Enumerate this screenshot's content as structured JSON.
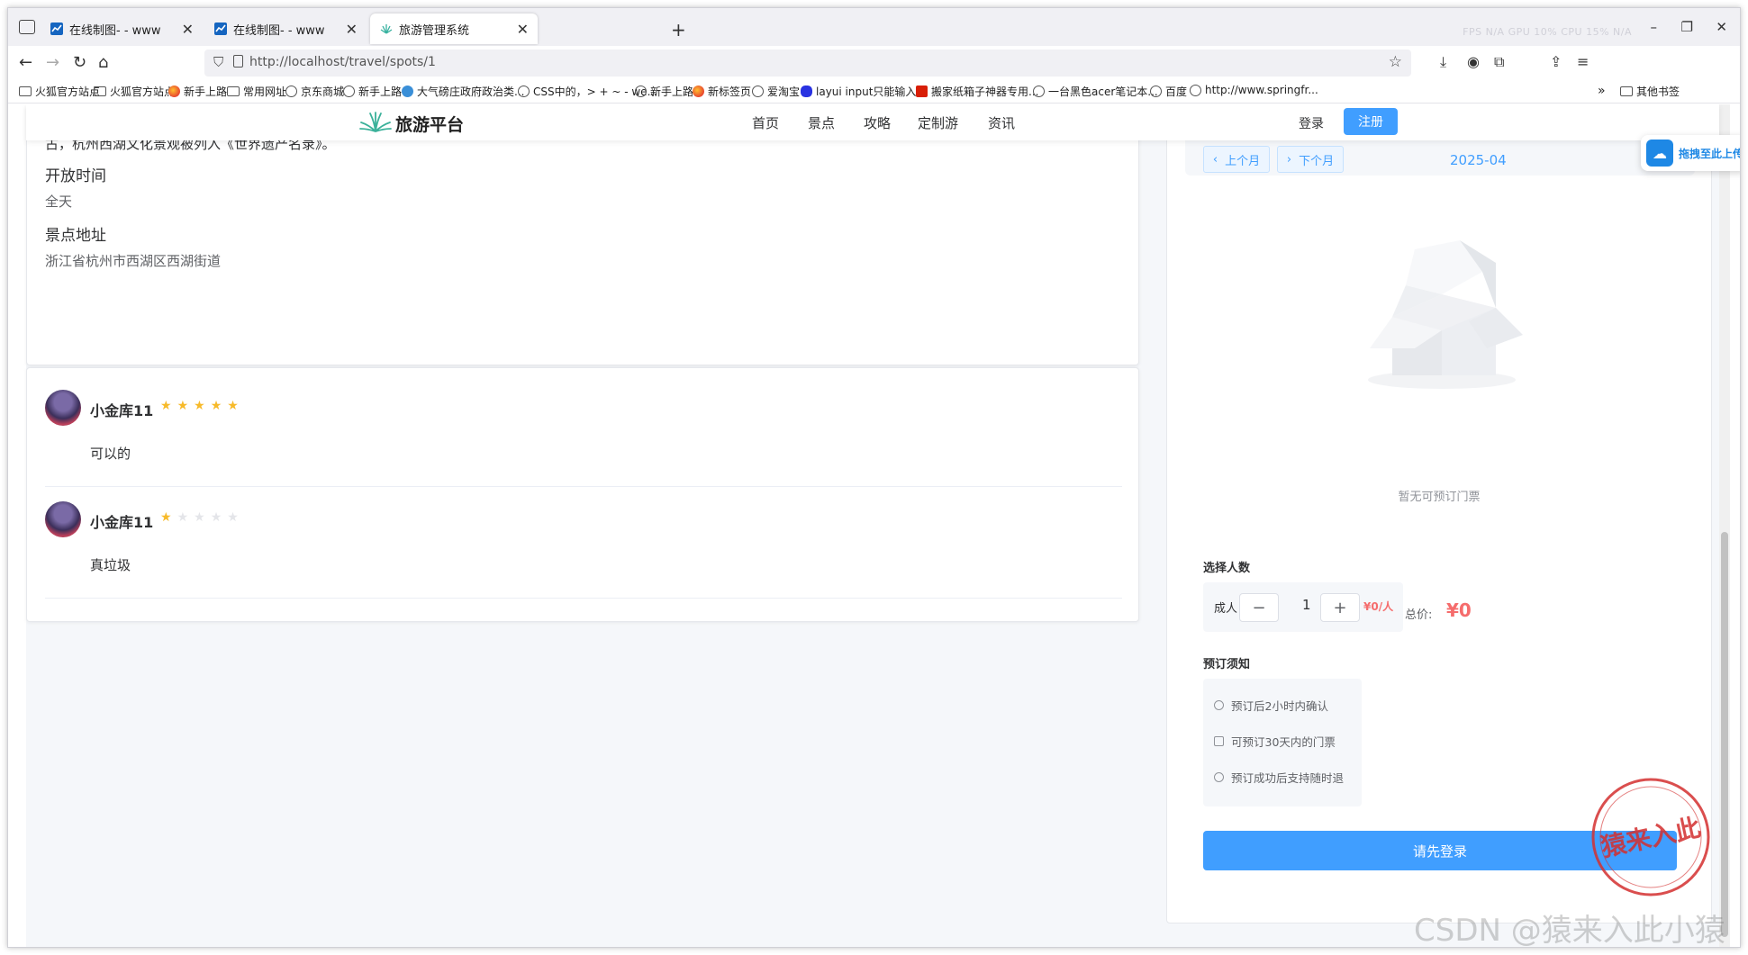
{
  "browser": {
    "tabs": [
      {
        "title": "在线制图- - www",
        "active": false
      },
      {
        "title": "在线制图- - www",
        "active": false
      },
      {
        "title": "旅游管理系统",
        "active": true
      }
    ],
    "sysinfo": "FPS N/A   GPU 10%   CPU 15%   N/A",
    "url": "http://localhost/travel/spots/1",
    "bookmarks": [
      {
        "label": "火狐官方站点",
        "icon": "folder-icon"
      },
      {
        "label": "火狐官方站点",
        "icon": "folder-icon"
      },
      {
        "label": "新手上路",
        "icon": "firefox-icon"
      },
      {
        "label": "常用网址",
        "icon": "folder-icon"
      },
      {
        "label": "京东商城",
        "icon": "globe-icon"
      },
      {
        "label": "新手上路",
        "icon": "globe-icon"
      },
      {
        "label": "大气磅庄政府政治类...",
        "icon": "sina-icon"
      },
      {
        "label": "CSS中的，> + ~ - we...",
        "icon": "css-icon"
      },
      {
        "label": "新手上路",
        "icon": "globe-icon"
      },
      {
        "label": "新标签页",
        "icon": "firefox-icon"
      },
      {
        "label": "爱淘宝",
        "icon": "globe-icon"
      },
      {
        "label": "layui input只能输入...",
        "icon": "paw-icon"
      },
      {
        "label": "搬家纸箱子神器专用...",
        "icon": "red-t-icon"
      },
      {
        "label": "一台黑色acer笔记本...",
        "icon": "globe-icon"
      },
      {
        "label": "百度",
        "icon": "globe-icon"
      },
      {
        "label": "http://www.springfr...",
        "icon": "globe-icon"
      }
    ],
    "overflow": "»",
    "other_bookmarks": "其他书签"
  },
  "site": {
    "brand": "旅游平台",
    "nav": [
      "首页",
      "景点",
      "攻略",
      "定制游",
      "资讯"
    ],
    "login": "登录",
    "register": "注册"
  },
  "detail": {
    "cut_text": "古，杭州西湖文化景观被列入《世界遗产名录》。",
    "open_time_title": "开放时间",
    "open_time": "全天",
    "address_title": "景点地址",
    "address": "浙江省杭州市西湖区西湖街道"
  },
  "reviews": [
    {
      "user": "小金库11",
      "rating": 5,
      "text": "可以的"
    },
    {
      "user": "小金库11",
      "rating": 1,
      "text": "真垃圾"
    }
  ],
  "booking": {
    "prev_month": "上个月",
    "next_month": "下个月",
    "month": "2025-04",
    "empty_text": "暂无可预订门票",
    "people_label": "选择人数",
    "adult": "成人",
    "quantity": "1",
    "unit_price": "¥0/人",
    "total_label": "总价:",
    "total": "¥0",
    "notice_label": "预订须知",
    "notices": [
      "预订后2小时内确认",
      "可预订30天内的门票",
      "预订成功后支持随时退"
    ],
    "login_button": "请先登录"
  },
  "floating": {
    "drag_upload": "拖拽至此上传"
  },
  "watermark": {
    "text": "CSDN @猿来入此小猿",
    "seal_text": "猿来入此"
  },
  "colors": {
    "primary": "#409eff",
    "price": "#f56c6c",
    "star": "#f7ba2a"
  }
}
